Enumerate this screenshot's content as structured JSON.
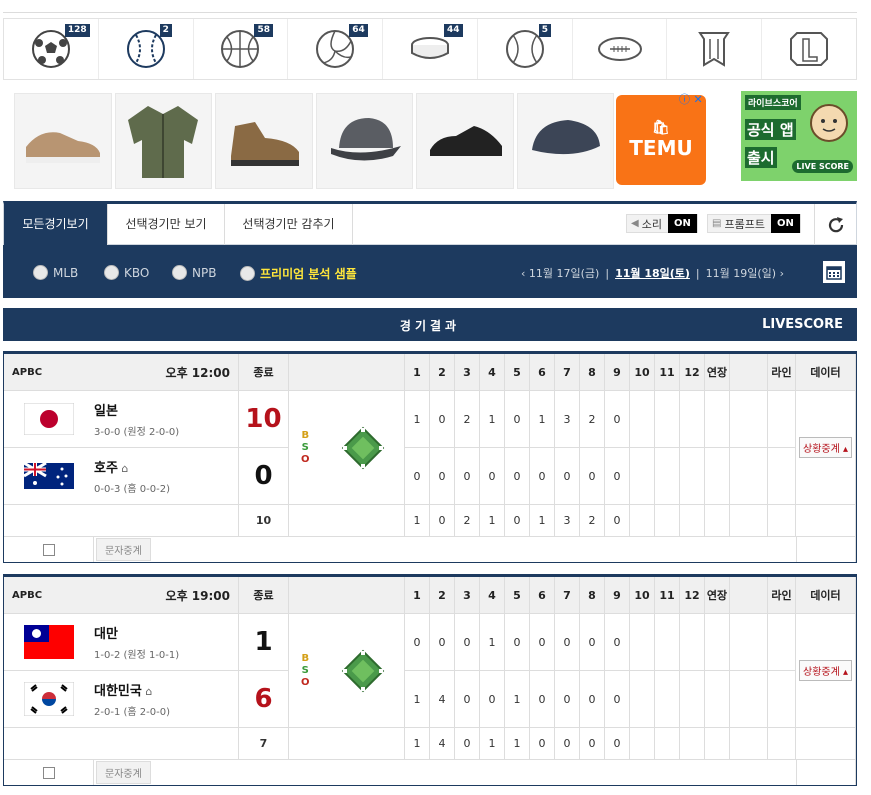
{
  "sports": [
    {
      "name": "soccer-icon",
      "count": "128"
    },
    {
      "name": "baseball-icon",
      "count": "2"
    },
    {
      "name": "basketball-icon",
      "count": "58"
    },
    {
      "name": "volleyball-icon",
      "count": "64"
    },
    {
      "name": "hockey-puck-icon",
      "count": "44"
    },
    {
      "name": "tennis-ball-icon",
      "count": "5"
    },
    {
      "name": "football-icon",
      "count": ""
    },
    {
      "name": "lol-icon",
      "count": ""
    },
    {
      "name": "league-icon",
      "count": ""
    }
  ],
  "ads": {
    "temu_label": "TEMU",
    "temu_mark": "🛍",
    "banner_top": "라이브스코어",
    "banner_mid": "공식 앱",
    "banner_bottom": "출시",
    "banner_badge": "LIVE SCORE",
    "close_mark": "ⓘ ✕"
  },
  "tabs": {
    "all": "모든경기보기",
    "selected": "선택경기만 보기",
    "hide": "선택경기만 감추기",
    "sound_label": "소리",
    "sound_state": "ON",
    "prompt_label": "프롬프트",
    "prompt_state": "ON"
  },
  "filters": {
    "mlb": "MLB",
    "kbo": "KBO",
    "npb": "NPB",
    "premium": "프리미엄 분석 샘플",
    "prev_date": "‹  11월 17일(금)",
    "current_date": "11월 18일(토)",
    "next_date": "11월 19일(일)  ›",
    "separator": "|"
  },
  "results": {
    "title": "경기결과",
    "livescore": "LIVESCORE"
  },
  "headers": {
    "status": "종료",
    "innings": [
      "1",
      "2",
      "3",
      "4",
      "5",
      "6",
      "7",
      "8",
      "9",
      "10",
      "11",
      "12"
    ],
    "extra": "연장",
    "line": "라인",
    "data": "데이터",
    "bso": [
      "B",
      "S",
      "O"
    ],
    "live_btn": "상황중계 ▴",
    "text_btn": "문자중계"
  },
  "games": [
    {
      "league": "APBC",
      "time": "오후 12:00",
      "away": {
        "name": "일본",
        "record": "3-0-0 (원정 2-0-0)",
        "score": "10",
        "innings": [
          "1",
          "0",
          "2",
          "1",
          "0",
          "1",
          "3",
          "2",
          "0"
        ],
        "flag": "japan"
      },
      "home": {
        "name": "호주",
        "record": "0-0-3 (홈 0-0-2)",
        "score": "0",
        "innings": [
          "0",
          "0",
          "0",
          "0",
          "0",
          "0",
          "0",
          "0",
          "0"
        ],
        "flag": "australia"
      },
      "total": {
        "score": "10",
        "innings": [
          "1",
          "0",
          "2",
          "1",
          "0",
          "1",
          "3",
          "2",
          "0"
        ]
      }
    },
    {
      "league": "APBC",
      "time": "오후 19:00",
      "away": {
        "name": "대만",
        "record": "1-0-2 (원정 1-0-1)",
        "score": "1",
        "innings": [
          "0",
          "0",
          "0",
          "1",
          "0",
          "0",
          "0",
          "0",
          "0"
        ],
        "flag": "taiwan"
      },
      "home": {
        "name": "대한민국",
        "record": "2-0-1 (홈 2-0-0)",
        "score": "6",
        "innings": [
          "1",
          "4",
          "0",
          "0",
          "1",
          "0",
          "0",
          "0",
          "0"
        ],
        "flag": "korea"
      },
      "total": {
        "score": "7",
        "innings": [
          "1",
          "4",
          "0",
          "1",
          "1",
          "0",
          "0",
          "0",
          "0"
        ]
      }
    }
  ],
  "colors": {
    "navy": "#1d3a5f",
    "red": "#b5121b",
    "premium": "#ffe63b",
    "temu": "#f97316"
  }
}
